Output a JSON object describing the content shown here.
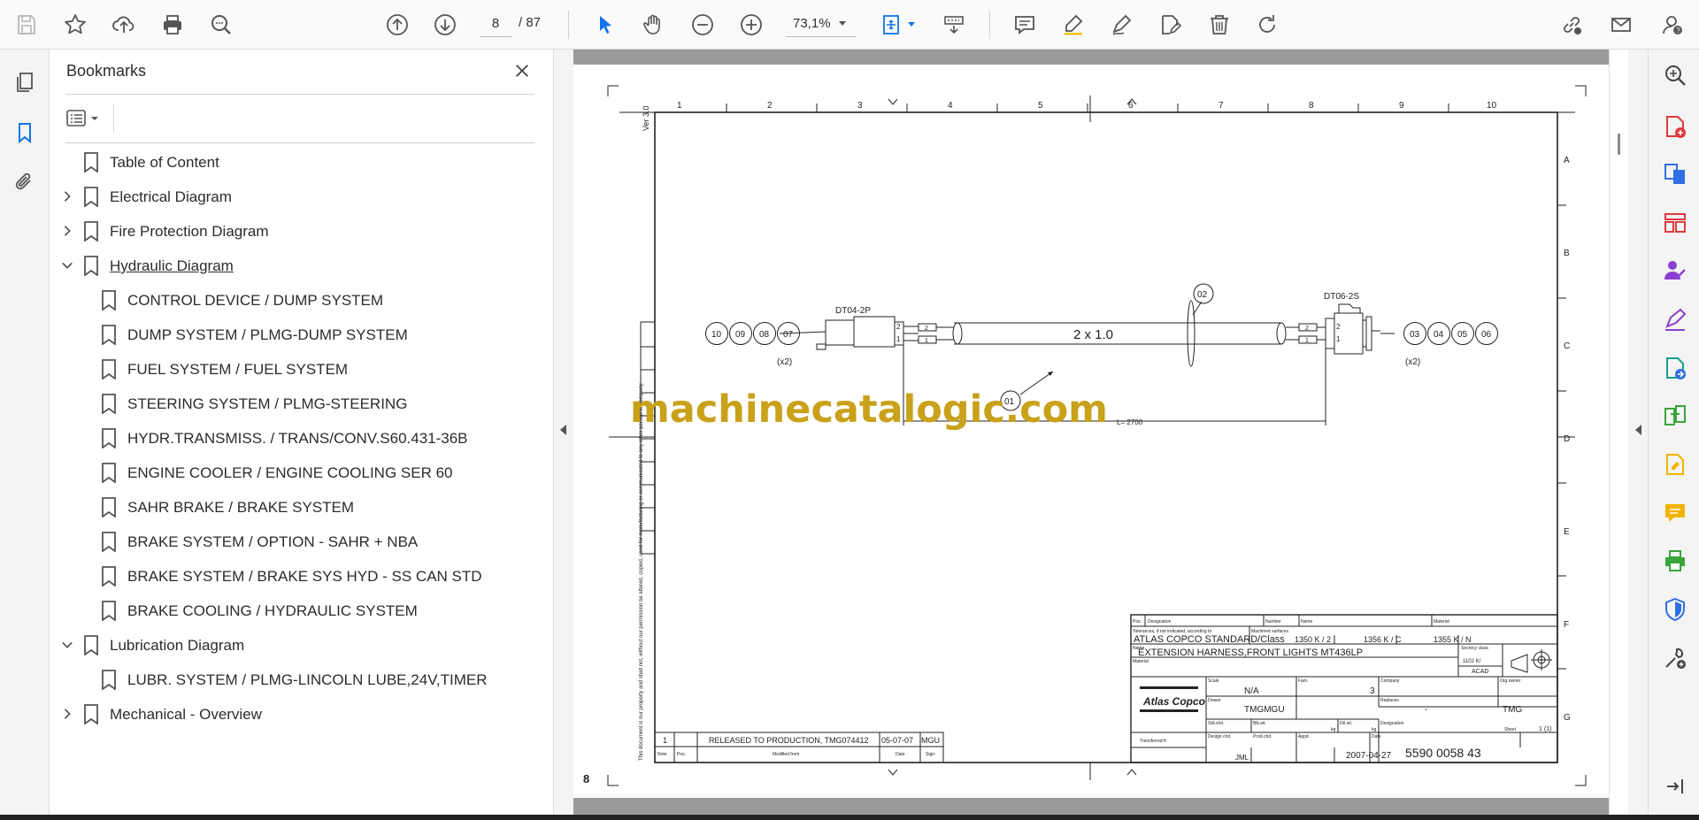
{
  "toolbar": {
    "page_current": "8",
    "page_total": "/ 87",
    "zoom": "73,1%"
  },
  "bookmarks": {
    "title": "Bookmarks",
    "items": [
      {
        "label": "Table of Content",
        "level": 0,
        "expander": "none"
      },
      {
        "label": "Electrical Diagram",
        "level": 0,
        "expander": "collapsed"
      },
      {
        "label": "Fire Protection Diagram",
        "level": 0,
        "expander": "collapsed"
      },
      {
        "label": "Hydraulic Diagram",
        "level": 0,
        "expander": "expanded"
      },
      {
        "label": "CONTROL DEVICE / DUMP SYSTEM",
        "level": 1
      },
      {
        "label": "DUMP SYSTEM / PLMG-DUMP SYSTEM",
        "level": 1
      },
      {
        "label": "FUEL SYSTEM / FUEL SYSTEM",
        "level": 1
      },
      {
        "label": "STEERING SYSTEM / PLMG-STEERING",
        "level": 1
      },
      {
        "label": "HYDR.TRANSMISS. / TRANS/CONV.S60.431-36B",
        "level": 1
      },
      {
        "label": "ENGINE COOLER / ENGINE COOLING SER 60",
        "level": 1
      },
      {
        "label": "SAHR BRAKE / BRAKE SYSTEM",
        "level": 1
      },
      {
        "label": "BRAKE SYSTEM / OPTION - SAHR + NBA",
        "level": 1
      },
      {
        "label": "BRAKE SYSTEM / BRAKE SYS HYD - SS CAN STD",
        "level": 1
      },
      {
        "label": "BRAKE COOLING / HYDRAULIC SYSTEM",
        "level": 1
      },
      {
        "label": "Lubrication Diagram",
        "level": 0,
        "expander": "expanded"
      },
      {
        "label": "LUBR. SYSTEM / PLMG-LINCOLN LUBE,24V,TIMER",
        "level": 1
      },
      {
        "label": "Mechanical - Overview",
        "level": 0,
        "expander": "collapsed"
      }
    ]
  },
  "drawing": {
    "page_label": "8",
    "watermark": "machinecatalogic.com",
    "version": "Ver 3.0",
    "cols": [
      "1",
      "2",
      "3",
      "4",
      "5",
      "6",
      "7",
      "8",
      "9",
      "10"
    ],
    "rows": [
      "A",
      "B",
      "C",
      "D",
      "E",
      "F",
      "G"
    ],
    "connector_left": "DT04-2P",
    "connector_right": "DT06-2S",
    "cable_label": "2 x 1.0",
    "length_label": "L= 2700",
    "callout_01": "01",
    "callout_02": "02",
    "left_circles": [
      "10",
      "09",
      "08",
      "07"
    ],
    "right_circles": [
      "03",
      "04",
      "05",
      "06"
    ],
    "left_qty": "(x2)",
    "right_qty": "(x2)",
    "pin2": "2",
    "pin1": "1",
    "disclaimer": "This document is our property and shall not, without our permission be altered, copied, used for manufacturing or communicated to any other person or company.",
    "rev": {
      "number": "1",
      "text": "RELEASED TO PRODUCTION, TMG074412",
      "date": "05-07-07",
      "sign": "MGU",
      "h_note": "Note",
      "h_pos": "Pos.",
      "h_modified": "Modified from",
      "h_date": "Date",
      "h_sign": "Sign."
    },
    "title_block": {
      "pos": "Pos.",
      "designation_h": "Designation",
      "number_h": "Number",
      "name_h": "Name",
      "material_h": "Material",
      "tolerances": "Tolerances, if not indicated, according to",
      "machined": "Machined surfaces",
      "standard": "ATLAS COPCO STANDARD/Class",
      "class1": "1350 K / 2",
      "class2": "1356 K / C",
      "class3": "1355 K / N",
      "name_label": "Name",
      "name": "EXTENSION HARNESS,FRONT LIGHTS MT436LP",
      "secrecy": "Secrecy class",
      "secrecy_val": "1102 K/",
      "acad": "ACAD",
      "material_label": "Material",
      "scale_label": "Scale",
      "scale": "N/A",
      "fam_label": "Fam.",
      "fam": "3",
      "company_label": "Company",
      "orgowner_label": "Org.owner",
      "drawn_label": "Drawn",
      "drawn": "TMGMGU",
      "replaces_label": "Replaces",
      "replaces": "-",
      "orgowner": "TMG",
      "stdchd": "Std.chd.",
      "blkwt": "Blk.wt.",
      "fillwt": "Fill.wt.",
      "kg": "kg",
      "designation_label": "Designation",
      "sheet_label": "Sheet",
      "sheet": "1 (1)",
      "transferred": "Transferred fr.",
      "design_chd": "Design chd.",
      "design_chd_val": "JML",
      "prodchd": "Prod.chd.",
      "appd": "Appd.",
      "date_label": "Date",
      "date": "2007-04-27",
      "designation": "5590 0058 43",
      "logo": "Atlas Copco"
    }
  }
}
